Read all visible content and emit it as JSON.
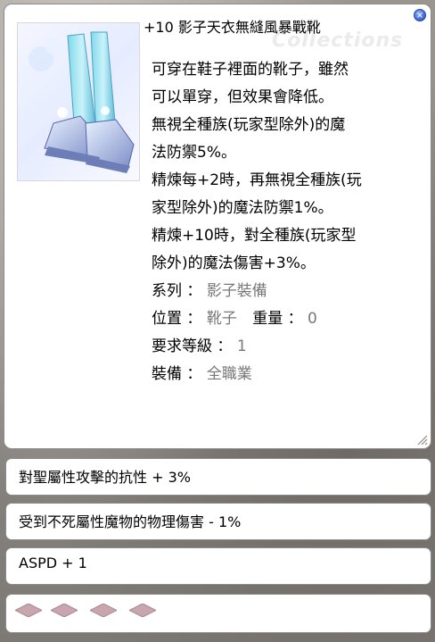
{
  "item": {
    "title": "+10 影子天衣無縫風暴戰靴",
    "description_lines": [
      "可穿在鞋子裡面的靴子，雖然",
      "可以單穿，但效果會降低。",
      "無視全種族(玩家型除外)的魔",
      "法防禦5%。",
      "精煉每+2時，再無視全種族(玩",
      "家型除外)的魔法防禦1%。",
      "精煉+10時，對全種族(玩家型",
      "除外)的魔法傷害+3%。"
    ],
    "properties": {
      "type_label": "系列 ：",
      "type_value": "影子裝備",
      "location_label": "位置 ：",
      "location_value": "靴子",
      "weight_label": "重量 ：",
      "weight_value": "0",
      "level_label": "要求等級 ：",
      "level_value": "1",
      "job_label": "裝備 ：",
      "job_value": "全職業"
    }
  },
  "options": [
    "對聖屬性攻擊的抗性 + 3%",
    "受到不死屬性魔物的物理傷害 - 1%",
    "ASPD + 1"
  ],
  "card_slots": {
    "count": 4,
    "color": "#c9a6ad"
  },
  "icons": {
    "close": "close-icon",
    "item": "boots-icon",
    "resize": "resize-grip-icon",
    "card": "empty-card-slot-icon"
  }
}
